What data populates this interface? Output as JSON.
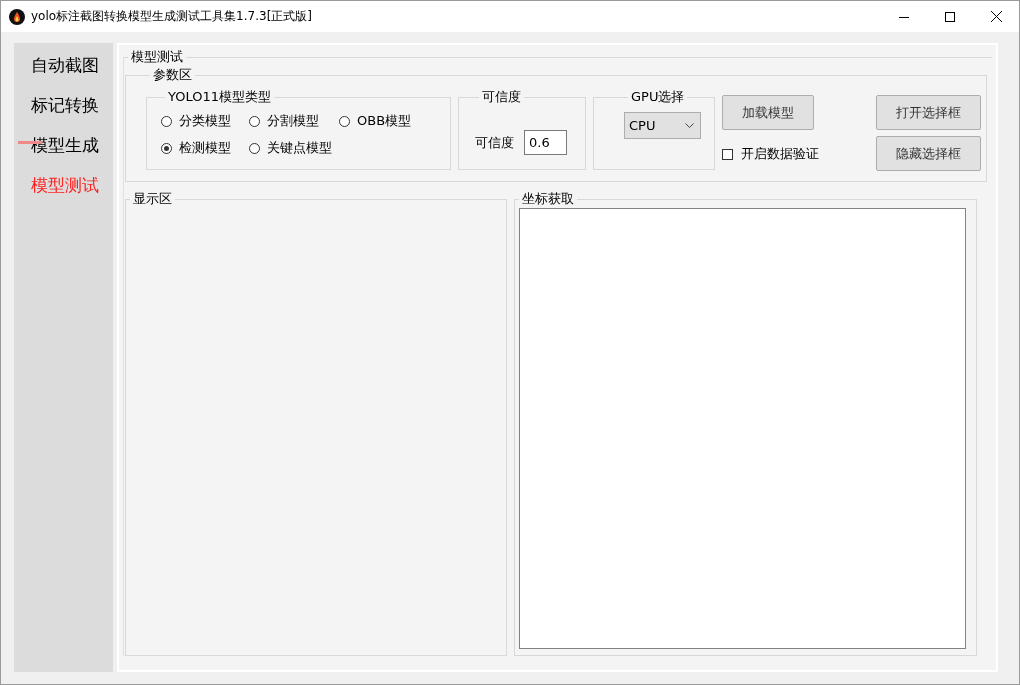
{
  "window": {
    "title": "yolo标注截图转换模型生成测试工具集1.7.3[正式版]"
  },
  "sidebar": {
    "items": [
      {
        "label": "自动截图",
        "selected": false
      },
      {
        "label": "标记转换",
        "selected": false
      },
      {
        "label": "模型生成",
        "selected": false
      },
      {
        "label": "模型测试",
        "selected": true
      }
    ]
  },
  "main": {
    "title": "模型测试",
    "params": {
      "title": "参数区",
      "model_type": {
        "title": "YOLO11模型类型",
        "options": [
          {
            "label": "分类模型",
            "selected": false
          },
          {
            "label": "分割模型",
            "selected": false
          },
          {
            "label": "OBB模型",
            "selected": false
          },
          {
            "label": "检测模型",
            "selected": true
          },
          {
            "label": "关键点模型",
            "selected": false
          }
        ]
      },
      "confidence": {
        "title": "可信度",
        "label": "可信度",
        "value": "0.6"
      },
      "gpu": {
        "title": "GPU选择",
        "value": "CPU"
      },
      "load_button": "加载模型",
      "validation": {
        "label": "开启数据验证",
        "checked": false
      },
      "open_button": "打开选择框",
      "hide_button": "隐藏选择框"
    },
    "display": {
      "title": "显示区"
    },
    "coords": {
      "title": "坐标获取"
    }
  }
}
